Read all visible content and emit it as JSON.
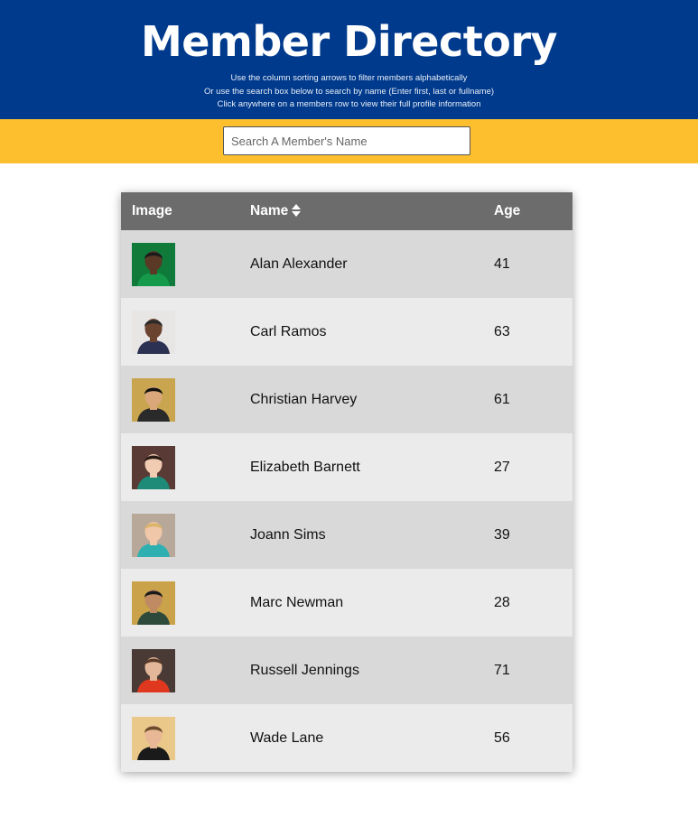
{
  "header": {
    "title": "Member Directory",
    "hints": [
      "Use the column sorting arrows to filter members alphabetically",
      "Or use the search box below to search by name (Enter first, last or fullname)",
      "Click anywhere on a members row to view their full profile information"
    ]
  },
  "search": {
    "placeholder": "Search A Member's Name",
    "value": ""
  },
  "table": {
    "columns": [
      "Image",
      "Name",
      "Age"
    ],
    "sort_icon": "sort-updown-icon",
    "rows": [
      {
        "name": "Alan Alexander",
        "age": "41",
        "avatar": {
          "bg": "#0f7a3a",
          "skin": "#5a3a26",
          "hair": "#1a1a1a",
          "shirt": "#159a4c"
        }
      },
      {
        "name": "Carl Ramos",
        "age": "63",
        "avatar": {
          "bg": "#e8e6e4",
          "skin": "#6b4430",
          "hair": "#2a2a2a",
          "shirt": "#2b3152"
        }
      },
      {
        "name": "Christian Harvey",
        "age": "61",
        "avatar": {
          "bg": "#c9a54f",
          "skin": "#d9a77a",
          "hair": "#111111",
          "shirt": "#2a2a2a"
        }
      },
      {
        "name": "Elizabeth Barnett",
        "age": "27",
        "avatar": {
          "bg": "#5a3a34",
          "skin": "#f1cbb2",
          "hair": "#2a1a14",
          "shirt": "#1e8a78"
        }
      },
      {
        "name": "Joann Sims",
        "age": "39",
        "avatar": {
          "bg": "#b8a89a",
          "skin": "#f0c7a8",
          "hair": "#d9b46a",
          "shirt": "#2fb0b0"
        }
      },
      {
        "name": "Marc Newman",
        "age": "28",
        "avatar": {
          "bg": "#c9a24a",
          "skin": "#c08a62",
          "hair": "#1a1a1a",
          "shirt": "#2d4a3a"
        }
      },
      {
        "name": "Russell Jennings",
        "age": "71",
        "avatar": {
          "bg": "#4a3a36",
          "skin": "#e3b89a",
          "hair": "#5a3a28",
          "shirt": "#e0381e"
        }
      },
      {
        "name": "Wade Lane",
        "age": "56",
        "avatar": {
          "bg": "#e9c889",
          "skin": "#e8b896",
          "hair": "#6a4a2a",
          "shirt": "#1a1a1a"
        }
      }
    ]
  }
}
